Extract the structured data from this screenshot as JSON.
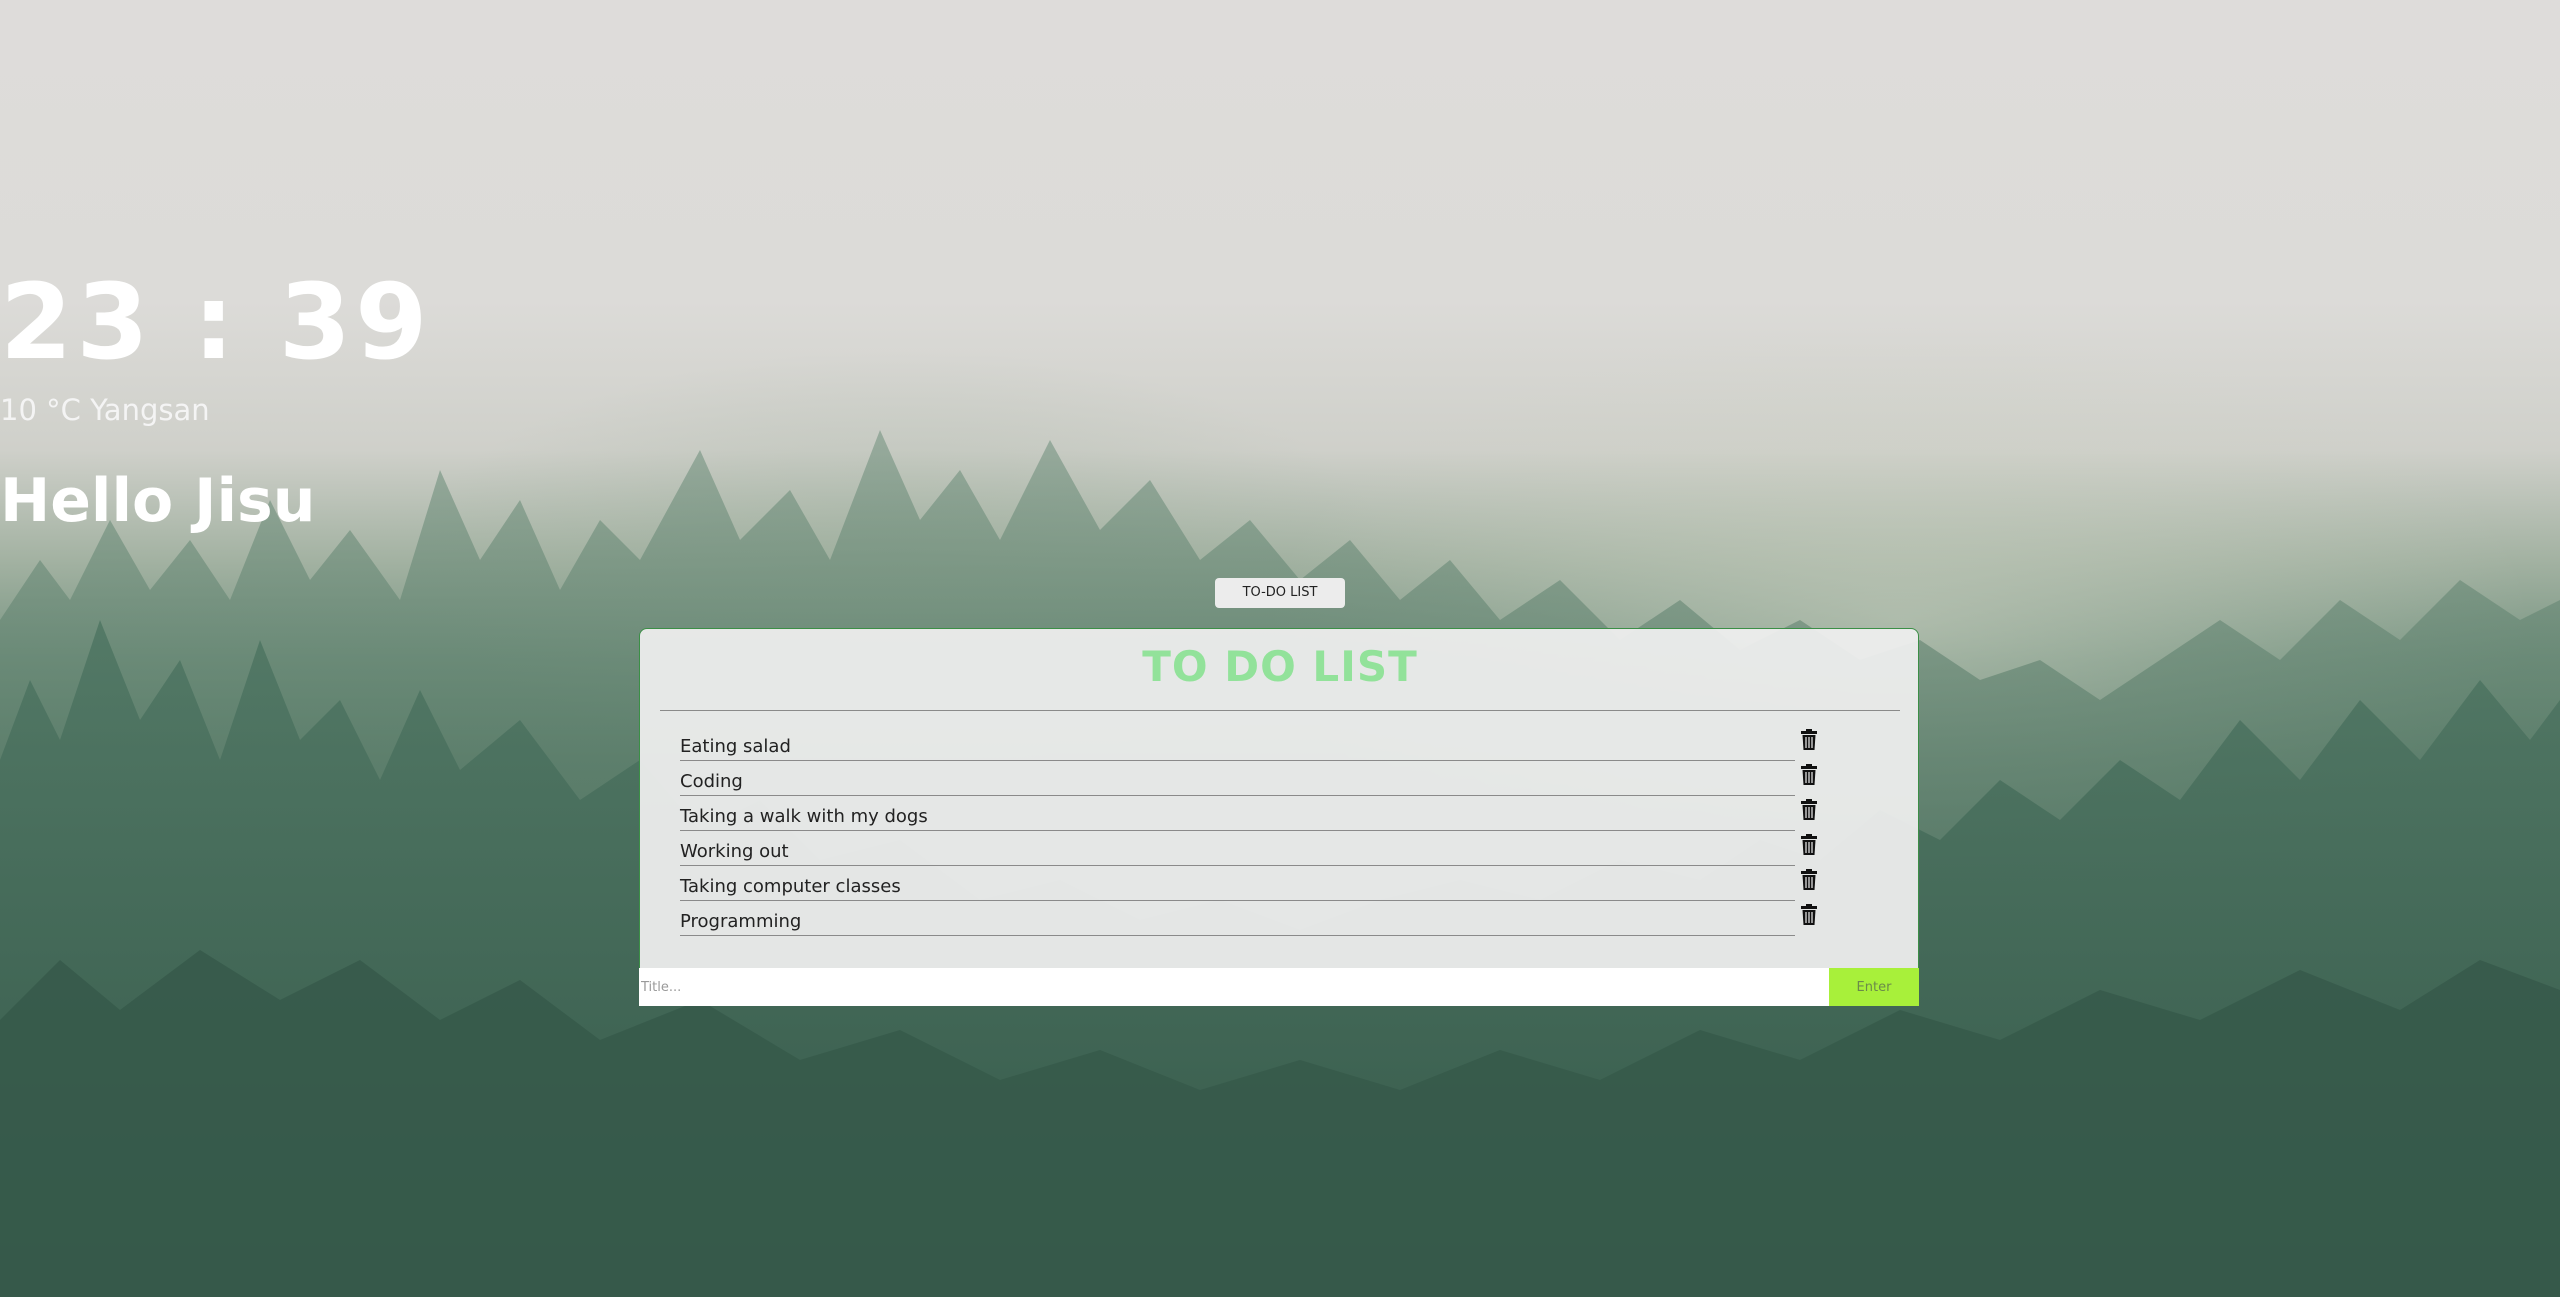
{
  "clock": {
    "hours": "23",
    "separator": ":",
    "minutes": "39",
    "display": "23 : 39"
  },
  "weather": {
    "text": "10 °C Yangsan"
  },
  "greeting": {
    "text": "Hello Jisu"
  },
  "toggle_button": {
    "label": "TO-DO LIST"
  },
  "todo": {
    "title": "TO DO LIST",
    "items": [
      {
        "text": "Eating salad",
        "icon": "trash-icon"
      },
      {
        "text": "Coding",
        "icon": "trash-icon"
      },
      {
        "text": "Taking a walk with my dogs",
        "icon": "trash-icon"
      },
      {
        "text": "Working out",
        "icon": "trash-icon"
      },
      {
        "text": "Taking computer classes",
        "icon": "trash-icon"
      },
      {
        "text": "Programming",
        "icon": "trash-icon"
      }
    ],
    "input": {
      "placeholder": "Title...",
      "value": ""
    },
    "enter_label": "Enter"
  },
  "colors": {
    "title_green": "#92e29a",
    "enter_button": "#a8f03a",
    "panel_border": "#3b8f46"
  }
}
